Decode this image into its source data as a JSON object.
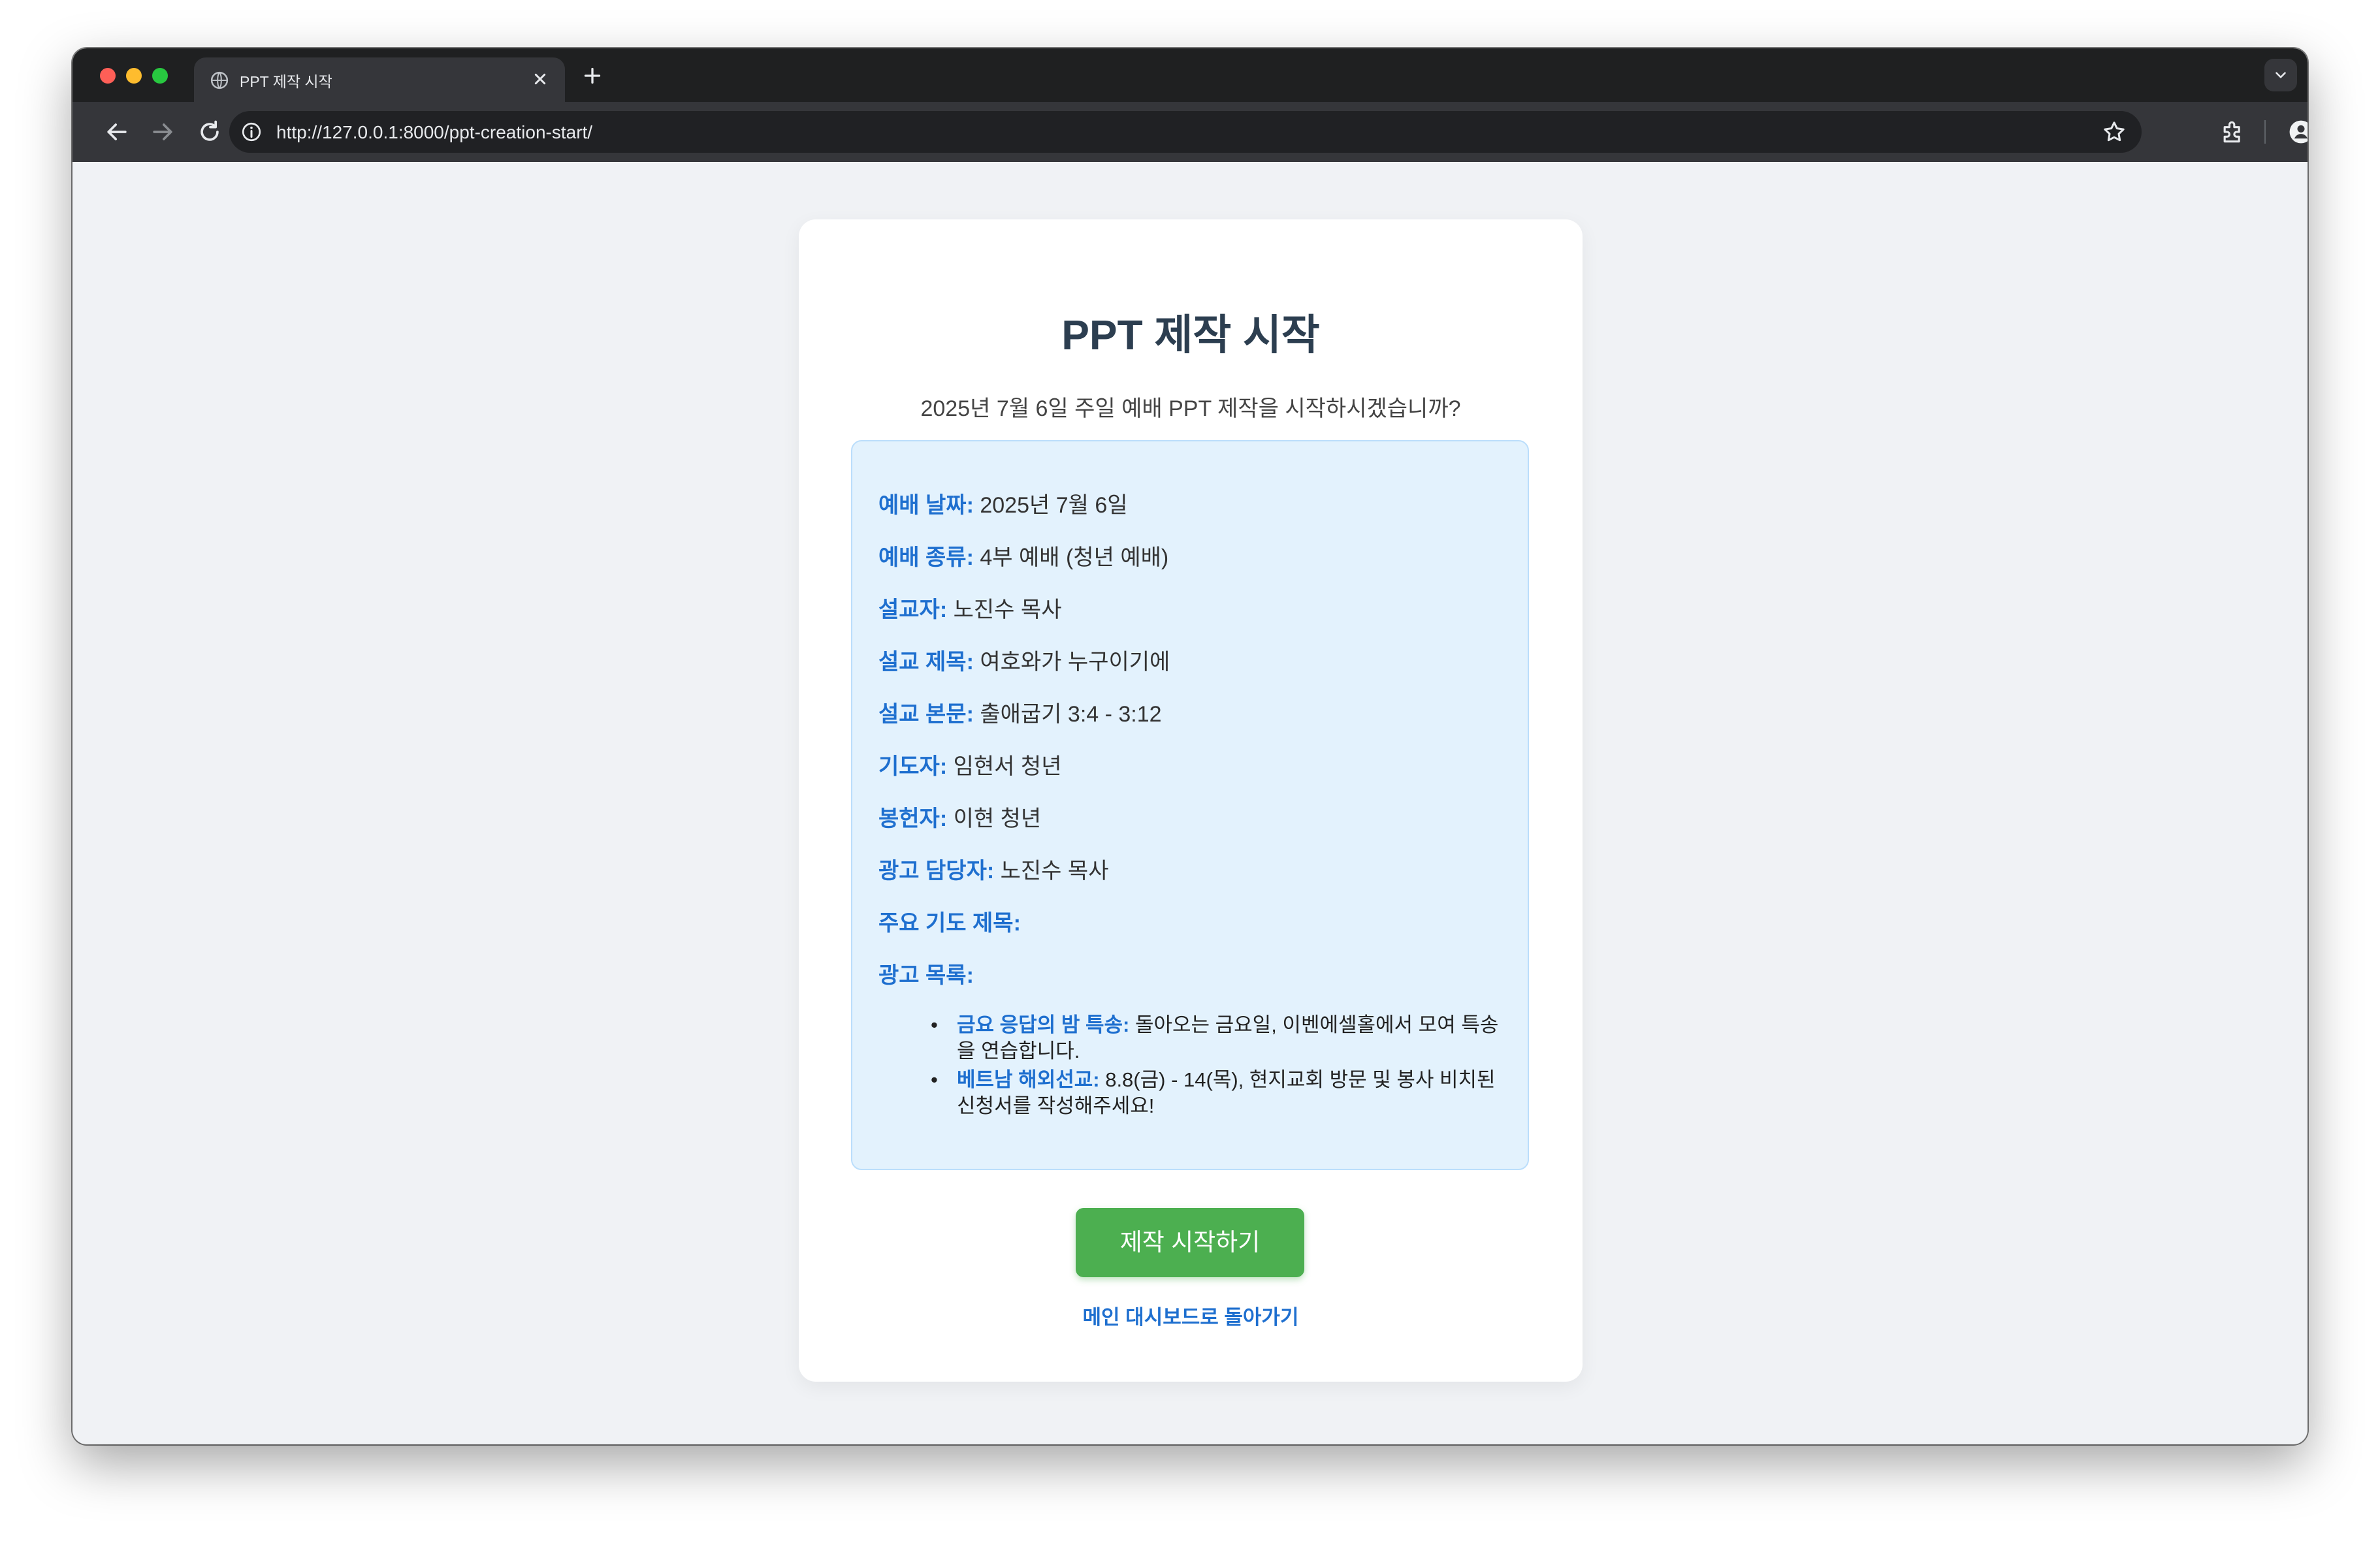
{
  "browser": {
    "tab_title": "PPT 제작 시작",
    "url": "http://127.0.0.1:8000/ppt-creation-start/"
  },
  "page": {
    "title": "PPT 제작 시작",
    "subtitle": "2025년 7월 6일 주일 예배 PPT 제작을 시작하시겠습니까?",
    "details": [
      {
        "label": "예배 날짜:",
        "value": "2025년 7월 6일"
      },
      {
        "label": "예배 종류:",
        "value": "4부 예배 (청년 예배)"
      },
      {
        "label": "설교자:",
        "value": "노진수 목사"
      },
      {
        "label": "설교 제목:",
        "value": "여호와가 누구이기에"
      },
      {
        "label": "설교 본문:",
        "value": "출애굽기 3:4 - 3:12"
      },
      {
        "label": "기도자:",
        "value": "임현서 청년"
      },
      {
        "label": "봉헌자:",
        "value": "이현 청년"
      },
      {
        "label": "광고 담당자:",
        "value": "노진수 목사"
      },
      {
        "label": "주요 기도 제목:",
        "value": ""
      },
      {
        "label": "광고 목록:",
        "value": ""
      }
    ],
    "ads": [
      {
        "title": "금요 응답의 밤 특송:",
        "body": "돌아오는 금요일, 이벤에셀홀에서 모여 특송을 연습합니다."
      },
      {
        "title": "베트남 해외선교:",
        "body": "8.8(금) - 14(목), 현지교회 방문 및 봉사 비치된 신청서를 작성해주세요!"
      }
    ],
    "start_button": "제작 시작하기",
    "back_link": "메인 대시보드로 돌아가기"
  }
}
